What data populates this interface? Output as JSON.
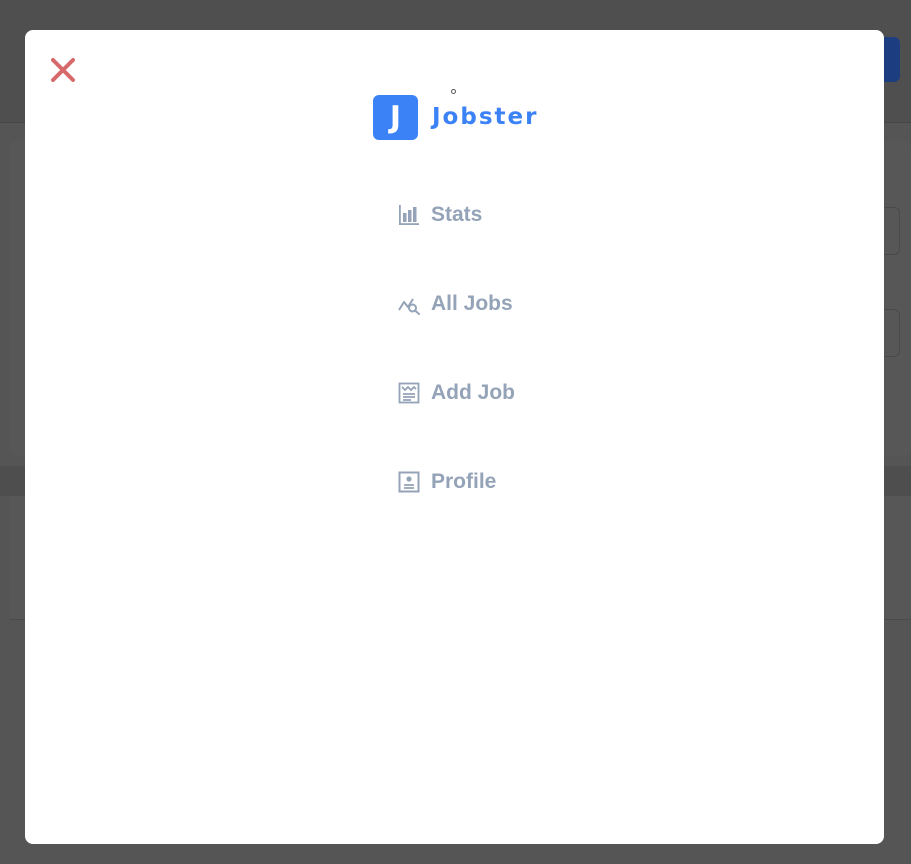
{
  "logo": {
    "mark": "J",
    "name": "Jobster"
  },
  "nav": [
    {
      "label": "Stats",
      "icon": "stats-icon"
    },
    {
      "label": "All Jobs",
      "icon": "jobs-search-icon"
    },
    {
      "label": "Add Job",
      "icon": "form-icon"
    },
    {
      "label": "Profile",
      "icon": "profile-icon"
    }
  ],
  "colors": {
    "accent": "#3b82f6",
    "nav_text": "#94a3b8",
    "close": "#d66a6a",
    "overlay": "#555555"
  }
}
